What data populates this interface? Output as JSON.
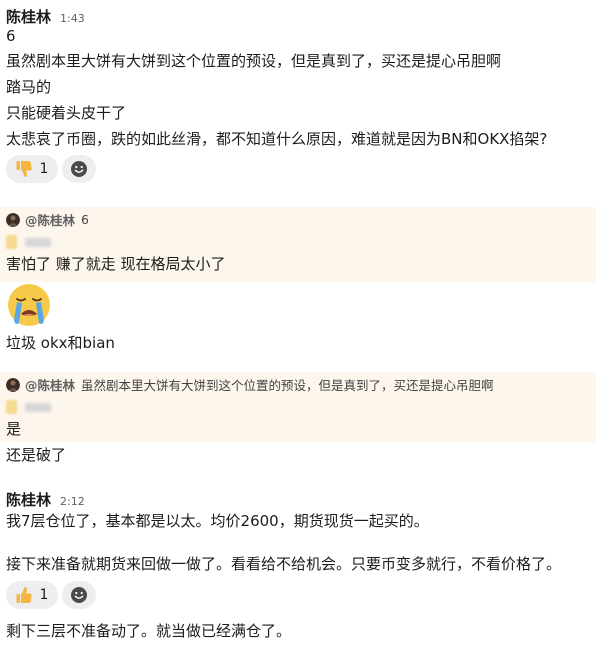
{
  "message1": {
    "author": "陈桂林",
    "time": "1:43",
    "lines": [
      "6",
      "虽然剧本里大饼有大饼到这个位置的预设，但是真到了，买还是提心吊胆啊",
      "踏马的",
      "只能硬着头皮干了",
      "太悲哀了币圈，跌的如此丝滑，都不知道什么原因，难道就是因为BN和OKX掐架?"
    ],
    "reactions": [
      {
        "icon": "thumbs-down-icon",
        "count": "1"
      },
      {
        "icon": "add-reaction-icon",
        "count": ""
      }
    ]
  },
  "reply1": {
    "quote_author": "@陈桂林",
    "quote_text": "6",
    "lines": [
      "害怕了 赚了就走 现在格局太小了"
    ],
    "emoji": "crying-face-icon",
    "after_line": "垃圾 okx和bian"
  },
  "reply2": {
    "quote_author": "@陈桂林",
    "quote_text": "虽然剧本里大饼有大饼到这个位置的预设，但是真到了，买还是提心吊胆啊",
    "lines": [
      "是"
    ],
    "after_line": "还是破了"
  },
  "message2": {
    "author": "陈桂林",
    "time": "2:12",
    "lines": [
      "我7层仓位了，基本都是以太。均价2600，期货现货一起买的。",
      "接下来准备就期货来回做一做了。看看给不给机会。只要币变多就行，不看价格了。"
    ],
    "reactions": [
      {
        "icon": "thumbs-up-icon",
        "count": "1"
      },
      {
        "icon": "add-reaction-icon",
        "count": ""
      }
    ],
    "after_line": "剩下三层不准备动了。就当做已经满仓了。"
  },
  "colors": {
    "highlight": "#fdf6ec",
    "reaction_bg": "#eeeef0",
    "text": "#1d1c1d",
    "muted": "#616061",
    "thumb": "#f4b63f"
  }
}
